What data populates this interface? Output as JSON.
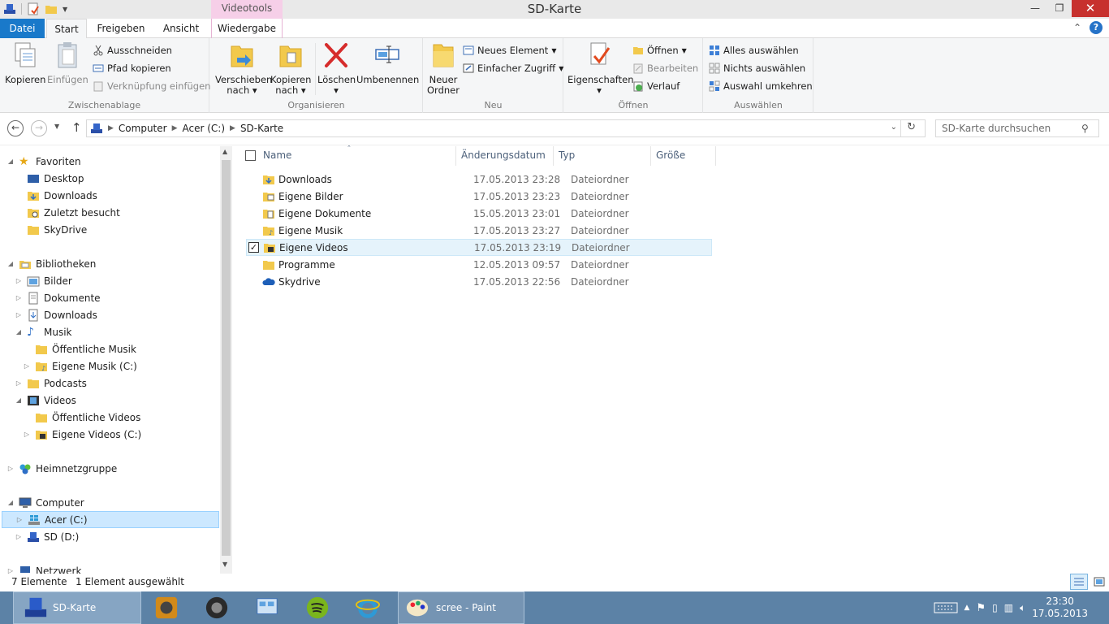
{
  "window": {
    "title": "SD-Karte",
    "context_tab_header": "Videotools"
  },
  "ribbon_tabs": [
    "Datei",
    "Start",
    "Freigeben",
    "Ansicht",
    "Wiedergabe"
  ],
  "ribbon": {
    "zwischenablage": {
      "label": "Zwischenablage",
      "kopieren": "Kopieren",
      "einfuegen": "Einfügen",
      "ausschneiden": "Ausschneiden",
      "pfad_kopieren": "Pfad kopieren",
      "verknuepfung_einfuegen": "Verknüpfung einfügen"
    },
    "organisieren": {
      "label": "Organisieren",
      "verschieben_line1": "Verschieben",
      "verschieben_line2": "nach",
      "kopieren_line1": "Kopieren",
      "kopieren_line2": "nach",
      "loeschen": "Löschen",
      "umbenennen": "Umbenennen"
    },
    "neu": {
      "label": "Neu",
      "neuer_line1": "Neuer",
      "neuer_line2": "Ordner",
      "neues_element": "Neues Element",
      "einfacher_zugriff": "Einfacher Zugriff"
    },
    "oeffnen": {
      "label": "Öffnen",
      "eigenschaften": "Eigenschaften",
      "oeffnen": "Öffnen",
      "bearbeiten": "Bearbeiten",
      "verlauf": "Verlauf"
    },
    "auswaehlen": {
      "label": "Auswählen",
      "alles": "Alles auswählen",
      "nichts": "Nichts auswählen",
      "umkehren": "Auswahl umkehren"
    }
  },
  "address": {
    "crumbs": [
      "Computer",
      "Acer (C:)",
      "SD-Karte"
    ],
    "search_placeholder": "SD-Karte durchsuchen"
  },
  "nav": {
    "favoriten": "Favoriten",
    "desktop": "Desktop",
    "downloads": "Downloads",
    "zuletzt": "Zuletzt besucht",
    "skydrive": "SkyDrive",
    "bibliotheken": "Bibliotheken",
    "bilder": "Bilder",
    "dokumente": "Dokumente",
    "lib_downloads": "Downloads",
    "musik": "Musik",
    "oeff_musik": "Öffentliche Musik",
    "eigene_musik": "Eigene Musik (C:)",
    "podcasts": "Podcasts",
    "videos": "Videos",
    "oeff_videos": "Öffentliche Videos",
    "eigene_videos": "Eigene Videos (C:)",
    "heimnetz": "Heimnetzgruppe",
    "computer": "Computer",
    "acer": "Acer (C:)",
    "sd": "SD (D:)",
    "netzwerk": "Netzwerk"
  },
  "columns": {
    "name": "Name",
    "date": "Änderungsdatum",
    "type": "Typ",
    "size": "Größe"
  },
  "files": [
    {
      "name": "Downloads",
      "date": "17.05.2013 23:28",
      "type": "Dateiordner"
    },
    {
      "name": "Eigene Bilder",
      "date": "17.05.2013 23:23",
      "type": "Dateiordner"
    },
    {
      "name": "Eigene Dokumente",
      "date": "15.05.2013 23:01",
      "type": "Dateiordner"
    },
    {
      "name": "Eigene Musik",
      "date": "17.05.2013 23:27",
      "type": "Dateiordner"
    },
    {
      "name": "Eigene Videos",
      "date": "17.05.2013 23:19",
      "type": "Dateiordner"
    },
    {
      "name": "Programme",
      "date": "12.05.2013 09:57",
      "type": "Dateiordner"
    },
    {
      "name": "Skydrive",
      "date": "17.05.2013 22:56",
      "type": "Dateiordner"
    }
  ],
  "status": {
    "count": "7 Elemente",
    "selected": "1 Element ausgewählt"
  },
  "taskbar": {
    "explorer": "SD-Karte",
    "paint": "scree - Paint",
    "time": "23:30",
    "date": "17.05.2013"
  },
  "colors": {
    "accent": "#1979ca",
    "context_tab": "#f6cfe8",
    "selection": "#cce8ff",
    "taskbar": "#5c82a6"
  }
}
